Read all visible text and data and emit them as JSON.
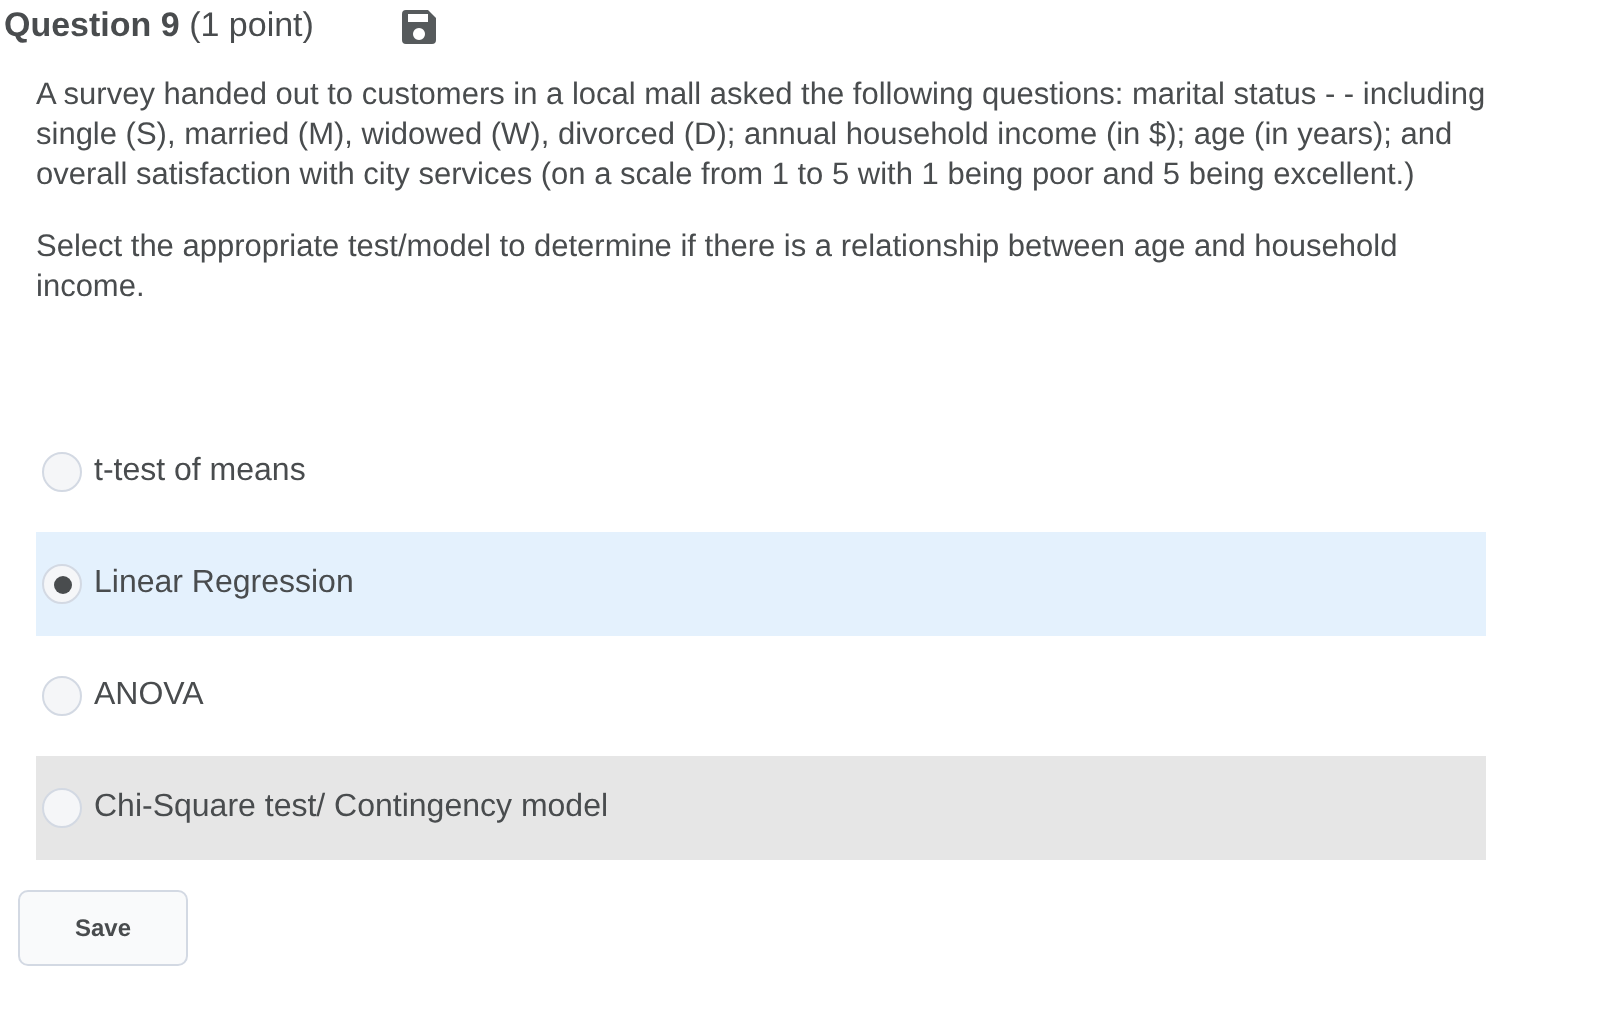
{
  "question": {
    "title": "**Question 9** (1 point)"
  },
  "prompt": [
    "A survey handed out to customers in a local mall asked the following questions: marital status - - including single (S), married (M), widowed (W), divorced (D); annual household income (in $); age (in years); and overall satisfaction with city services (on a scale from 1 to 5 with 1 being poor and 5 being excellent.)",
    "Select the appropriate test/model to determine if there is a relationship between age and household income."
  ],
  "options": [
    {
      "label": "t-test of means",
      "selected": false,
      "hovered": false
    },
    {
      "label": "Linear Regression",
      "selected": true,
      "hovered": false
    },
    {
      "label": "ANOVA",
      "selected": false,
      "hovered": false
    },
    {
      "label": "Chi-Square test/ Contingency model",
      "selected": false,
      "hovered": true
    }
  ],
  "save_button": "Save"
}
